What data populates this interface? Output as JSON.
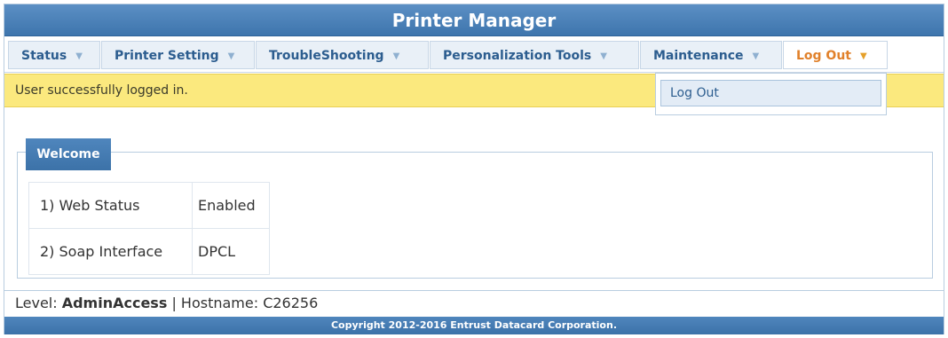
{
  "app": {
    "title": "Printer Manager"
  },
  "nav": {
    "items": [
      {
        "label": "Status"
      },
      {
        "label": "Printer Setting"
      },
      {
        "label": "TroubleShooting"
      },
      {
        "label": "Personalization Tools"
      },
      {
        "label": "Maintenance"
      },
      {
        "label": "Log Out"
      }
    ]
  },
  "message": {
    "text": "User successfully logged in."
  },
  "dropdown": {
    "items": [
      {
        "label": "Log Out"
      }
    ]
  },
  "welcome": {
    "tab_label": "Welcome",
    "rows": [
      {
        "key": "1) Web Status",
        "value": "Enabled"
      },
      {
        "key": "2) Soap Interface",
        "value": "DPCL"
      }
    ]
  },
  "status": {
    "level_label": "Level: ",
    "level_value": "AdminAccess",
    "separator": " | Hostname: ",
    "hostname": "C26256"
  },
  "footer": {
    "copyright": "Copyright 2012-2016 Entrust Datacard Corporation."
  },
  "colors": {
    "header_blue": "#3e75ad",
    "nav_text": "#2c5d8f",
    "active_orange": "#e1812b",
    "message_yellow": "#fbe97e"
  }
}
